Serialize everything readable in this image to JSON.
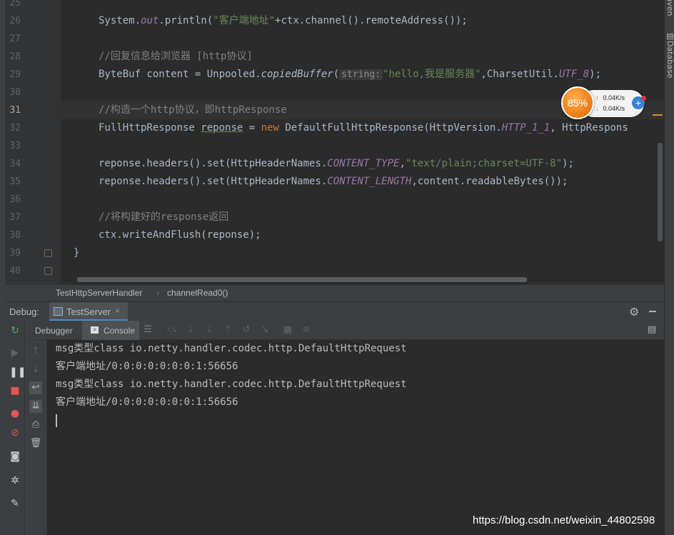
{
  "editor": {
    "line_numbers": [
      "25",
      "26",
      "27",
      "28",
      "29",
      "30",
      "31",
      "32",
      "33",
      "34",
      "35",
      "36",
      "37",
      "38",
      "39",
      "40"
    ],
    "current_line": "31",
    "lines": {
      "l26": {
        "a": "System.",
        "b": "out",
        "c": ".println(",
        "d": "\"客户端地址\"",
        "e": "+ctx.channel().remoteAddress());"
      },
      "l28": {
        "comment": "//回复信息给浏览器 [http协议]"
      },
      "l29": {
        "a": "ByteBuf content = Unpooled.",
        "b": "copiedBuffer",
        "c": "(",
        "hint": "string:",
        "d": "\"hello,我是服务器\"",
        "e": ",CharsetUtil.",
        "f": "UTF_8",
        "g": ");"
      },
      "l31": {
        "comment": "//构造一个http协议，即httpResponse"
      },
      "l32": {
        "a": "FullHttpResponse ",
        "b": "reponse",
        "c": " = ",
        "kw": "new",
        "d": " DefaultFullHttpResponse(HttpVersion.",
        "e": "HTTP_1_1",
        "f": ", HttpRespons"
      },
      "l34": {
        "a": "reponse.headers().set(HttpHeaderNames.",
        "b": "CONTENT_TYPE",
        "c": ",",
        "d": "\"text/plain;charset=UTF-8\"",
        "e": ");"
      },
      "l35": {
        "a": "reponse.headers().set(HttpHeaderNames.",
        "b": "CONTENT_LENGTH",
        "c": ",content.readableBytes());"
      },
      "l37": {
        "comment": "//将构建好的response返回"
      },
      "l38": {
        "a": "ctx.writeAndFlush(reponse);"
      },
      "l39": {
        "a": "}"
      }
    }
  },
  "right_tools": {
    "maven": "Maven",
    "database": "Database"
  },
  "net_widget": {
    "percent": "85%",
    "upload": "0.04K/s",
    "download": "0.04K/s"
  },
  "breadcrumb": {
    "class": "TestHttpServerHandler",
    "separator": "›",
    "method": "channelRead0()"
  },
  "debug": {
    "label": "Debug:",
    "tab": "TestServer",
    "tab_close": "×",
    "subtabs": {
      "debugger": "Debugger",
      "console": "Console"
    }
  },
  "console": {
    "lines": [
      "msg类型class io.netty.handler.codec.http.DefaultHttpRequest",
      "客户端地址/0:0:0:0:0:0:0:1:56656",
      "msg类型class io.netty.handler.codec.http.DefaultHttpRequest",
      "客户端地址/0:0:0:0:0:0:0:1:56656"
    ]
  },
  "watermark": "https://blog.csdn.net/weixin_44802598",
  "colors": {
    "keyword": "#cc7832",
    "string": "#6a8759",
    "field": "#9876aa",
    "comment": "#808080",
    "accent": "#4a88c7"
  }
}
